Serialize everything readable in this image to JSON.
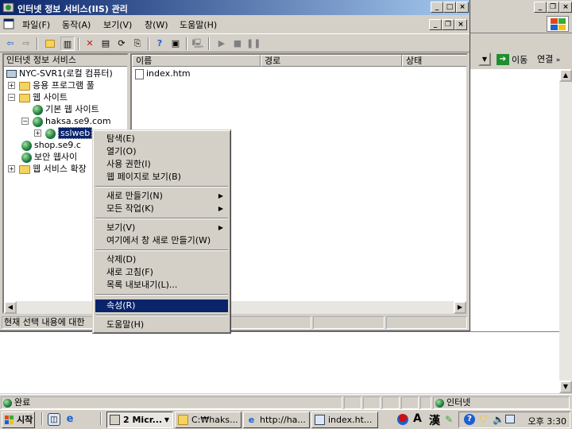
{
  "mmc": {
    "title": "인터넷 정보 서비스(IIS) 관리",
    "menu": [
      "파일(F)",
      "동작(A)",
      "보기(V)",
      "창(W)",
      "도움말(H)"
    ],
    "caption_buttons": [
      "_",
      "□",
      "×"
    ],
    "inner_caption_buttons": [
      "_",
      "❐",
      "×"
    ],
    "tree_header": "인터넷 정보 서비스",
    "tree": [
      {
        "label": "NYC-SVR1(로컬 컴퓨터)"
      },
      {
        "label": "응용 프로그램 풀"
      },
      {
        "label": "웹 사이트"
      },
      {
        "label": "기본 웹 사이트"
      },
      {
        "label": "haksa.se9.com"
      },
      {
        "label": "sslweb"
      },
      {
        "label": "shop.se9.c"
      },
      {
        "label": "보안 웹사이"
      },
      {
        "label": "웹 서비스 확장"
      }
    ],
    "columns": [
      "이름",
      "경로",
      "상태"
    ],
    "files": [
      "index.htm"
    ],
    "status_text": "현재 선택 내용에 대한"
  },
  "context_menu": {
    "items": [
      {
        "label": "탐색(E)"
      },
      {
        "label": "열기(O)"
      },
      {
        "label": "사용 권한(I)"
      },
      {
        "label": "웹 페이지로 보기(B)"
      },
      {
        "label": "새로 만들기(N)",
        "submenu": true
      },
      {
        "label": "모든 작업(K)",
        "submenu": true
      },
      {
        "label": "보기(V)",
        "submenu": true
      },
      {
        "label": "여기에서 창 새로 만들기(W)"
      },
      {
        "label": "삭제(D)"
      },
      {
        "label": "새로 고침(F)"
      },
      {
        "label": "목록 내보내기(L)..."
      },
      {
        "label": "속성(R)",
        "highlighted": true
      },
      {
        "label": "도움말(H)"
      }
    ]
  },
  "browser": {
    "caption_buttons": [
      "_",
      "❐",
      "×"
    ],
    "go_label": "이동",
    "links_label": "연결",
    "links_chevron": "»",
    "status_left": "완료",
    "status_zone": "인터넷"
  },
  "taskbar": {
    "start_label": "시작",
    "tasks": [
      {
        "label": "2 Micr...",
        "active": true
      },
      {
        "label": "C:₩haks..."
      },
      {
        "label": "http://ha..."
      },
      {
        "label": "index.ht..."
      }
    ],
    "tray_chars": [
      "A",
      "漢"
    ],
    "clock": "오후 3:30"
  },
  "colors": {
    "title_active_start": "#0a246a",
    "title_active_end": "#a6caf0",
    "highlight": "#0a246a",
    "face": "#d4d0c8"
  }
}
